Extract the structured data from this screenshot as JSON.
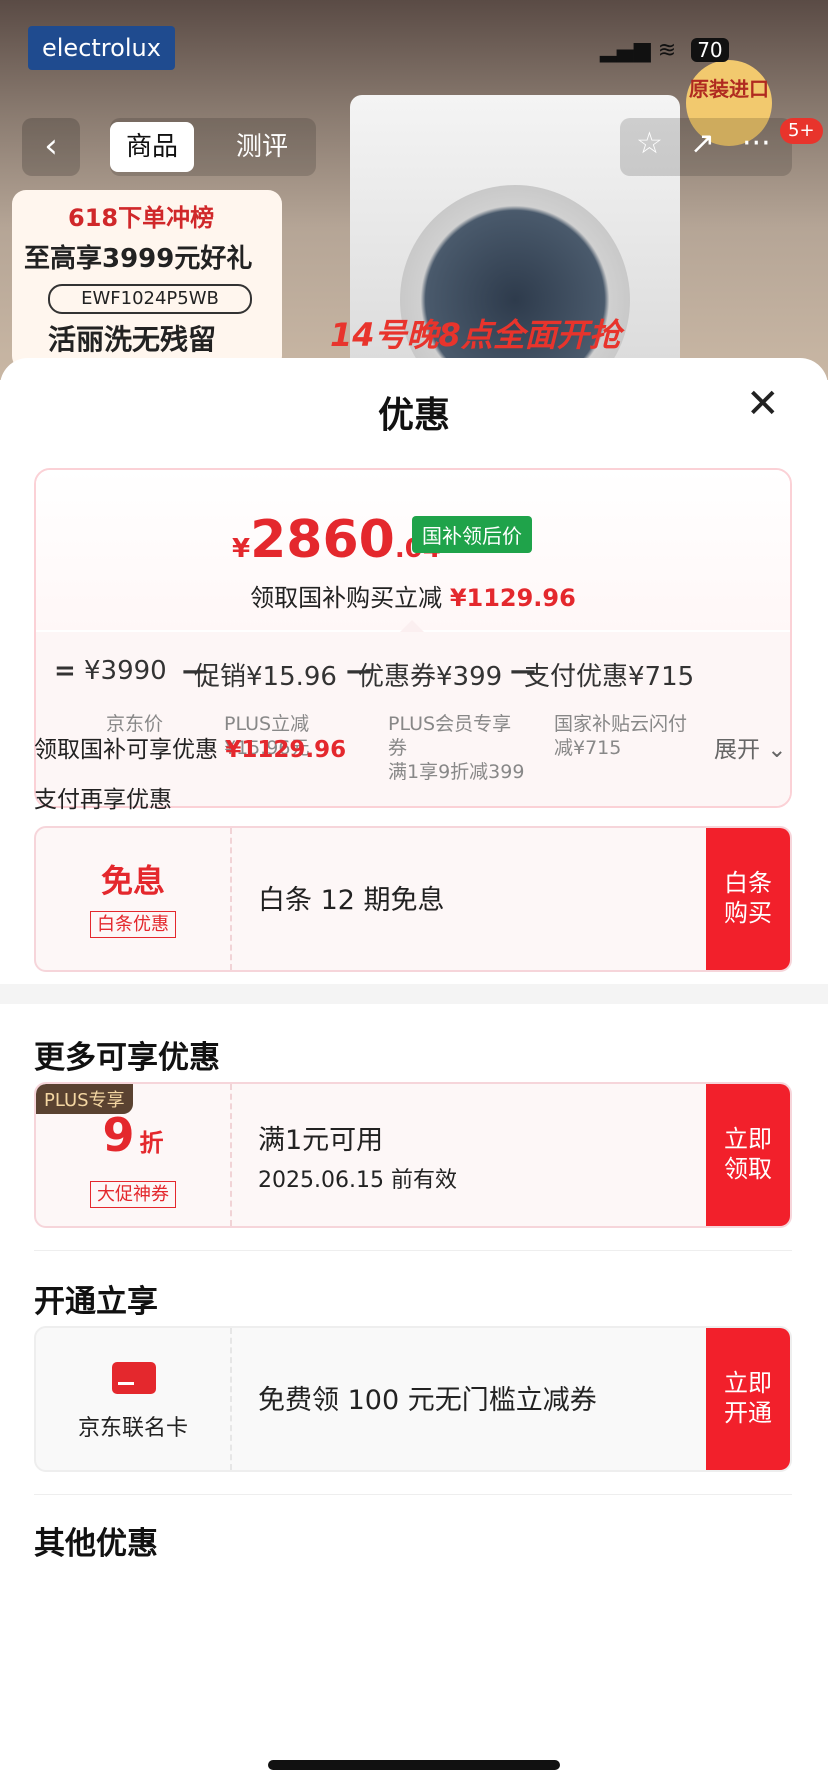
{
  "background": {
    "brand": "electrolux",
    "badge_origin": "原装进口",
    "promo_title": "618下单冲榜",
    "promo_gift": "至高享3999元好礼",
    "model": "EWF1024P5WB",
    "slogan": "活丽洗无残留",
    "banner": "14号晚8点全面开抢"
  },
  "status_bar": {
    "battery": "70"
  },
  "nav": {
    "back": "‹",
    "tab_product": "商品",
    "tab_review": "测评",
    "star": "☆",
    "share": "↗",
    "more": "···",
    "more_badge": "5+"
  },
  "sheet": {
    "title": "优惠",
    "close": "✕",
    "price": {
      "yen": "¥",
      "integer": "2860",
      "decimal": ".04",
      "tag": "国补领后价"
    },
    "subsidy_text": "领取国补购买立减",
    "subsidy_amount": "¥1129.96",
    "formula": {
      "eq": "=",
      "jd_price": "¥3990",
      "jd_price_label": "京东价",
      "promo": "促销¥15.96",
      "promo_label_1": "PLUS立减",
      "promo_label_2": "¥15.96元",
      "coupon": "优惠券¥399",
      "coupon_label_1": "PLUS会员专享",
      "coupon_label_2": "券",
      "coupon_label_3": "满1享9折减399",
      "pay": "支付优惠¥715",
      "pay_label_1": "国家补贴云闪付",
      "pay_label_2": "减¥715",
      "minus": "—"
    },
    "subsidy_line_text": "领取国补可享优惠",
    "subsidy_line_amount": "¥1129.96",
    "expand": "展开 ⌄",
    "pay_more": "支付再享优惠",
    "baitiao": {
      "big": "免息",
      "tag": "白条优惠",
      "text": "白条 12 期免息",
      "cta_1": "白条",
      "cta_2": "购买"
    },
    "more_title": "更多可享优惠",
    "plus_coupon": {
      "plus": "PLUS专享",
      "num": "9",
      "unit": "折",
      "tag": "大促神券",
      "line1": "满1元可用",
      "line2": "2025.06.15 前有效",
      "cta_1": "立即",
      "cta_2": "领取"
    },
    "open_title": "开通立享",
    "card": {
      "name": "京东联名卡",
      "text": "免费领 100 元无门槛立减券",
      "cta_1": "立即",
      "cta_2": "开通"
    },
    "other_title": "其他优惠"
  },
  "colors": {
    "accent": "#e4282d",
    "cta": "#f2202b",
    "green": "#1fa34a"
  }
}
